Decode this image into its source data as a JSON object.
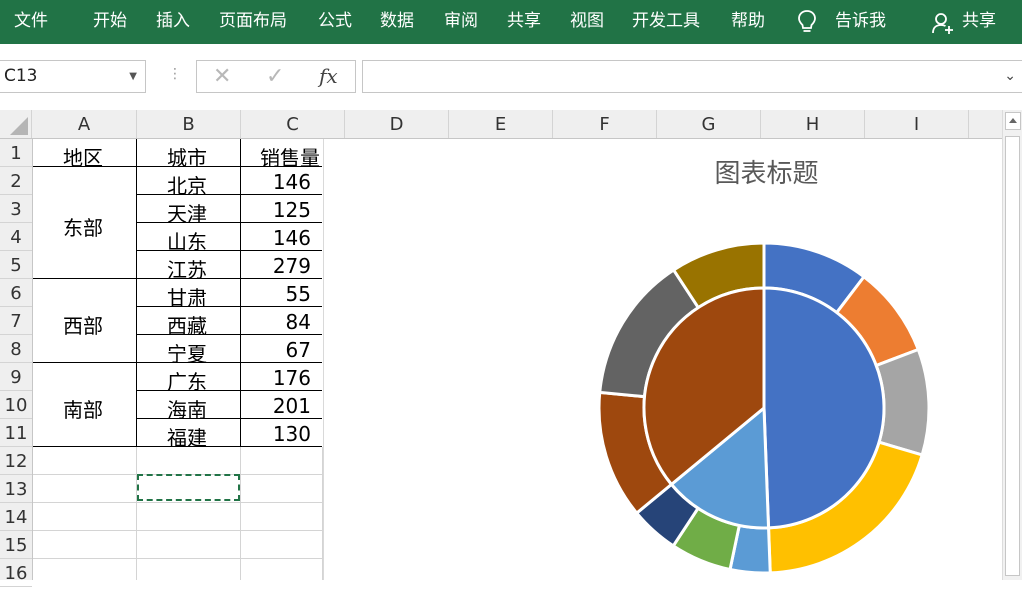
{
  "ribbon": {
    "tabs": [
      "文件",
      "开始",
      "插入",
      "页面布局",
      "公式",
      "数据",
      "审阅",
      "共享",
      "视图",
      "开发工具",
      "帮助"
    ],
    "tell_me": "告诉我",
    "share": "共享",
    "bg_color": "#217346"
  },
  "formula_bar": {
    "name_box": "C13",
    "cancel_symbol": "✕",
    "enter_symbol": "✓",
    "fx_label": "fx",
    "formula": ""
  },
  "columns": [
    "A",
    "B",
    "C",
    "D",
    "E",
    "F",
    "G",
    "H",
    "I"
  ],
  "rows": [
    "1",
    "2",
    "3",
    "4",
    "5",
    "6",
    "7",
    "8",
    "9",
    "10",
    "11",
    "12",
    "13",
    "14",
    "15",
    "16"
  ],
  "table": {
    "header": {
      "region": "地区",
      "city": "城市",
      "sales": "销售量"
    },
    "regions": [
      {
        "name": "东部",
        "cities": [
          {
            "city": "北京",
            "sales": "146"
          },
          {
            "city": "天津",
            "sales": "125"
          },
          {
            "city": "山东",
            "sales": "146"
          },
          {
            "city": "江苏",
            "sales": "279"
          }
        ]
      },
      {
        "name": "西部",
        "cities": [
          {
            "city": "甘肃",
            "sales": "55"
          },
          {
            "city": "西藏",
            "sales": "84"
          },
          {
            "city": "宁夏",
            "sales": "67"
          }
        ]
      },
      {
        "name": "南部",
        "cities": [
          {
            "city": "广东",
            "sales": "176"
          },
          {
            "city": "海南",
            "sales": "201"
          },
          {
            "city": "福建",
            "sales": "130"
          }
        ]
      }
    ]
  },
  "chart_data": {
    "type": "pie",
    "title": "图表标题",
    "inner": {
      "categories": [
        "东部",
        "西部",
        "南部"
      ],
      "values": [
        696,
        206,
        507
      ],
      "colors": [
        "#4472C4",
        "#5B9BD5",
        "#9E480E"
      ]
    },
    "outer": {
      "categories": [
        "北京",
        "天津",
        "山东",
        "江苏",
        "甘肃",
        "西藏",
        "宁夏",
        "广东",
        "海南",
        "福建"
      ],
      "values": [
        146,
        125,
        146,
        279,
        55,
        84,
        67,
        176,
        201,
        130
      ],
      "colors": [
        "#4472C4",
        "#ED7D31",
        "#A5A5A5",
        "#FFC000",
        "#5B9BD5",
        "#70AD47",
        "#264478",
        "#9E480E",
        "#636363",
        "#997300"
      ]
    }
  }
}
